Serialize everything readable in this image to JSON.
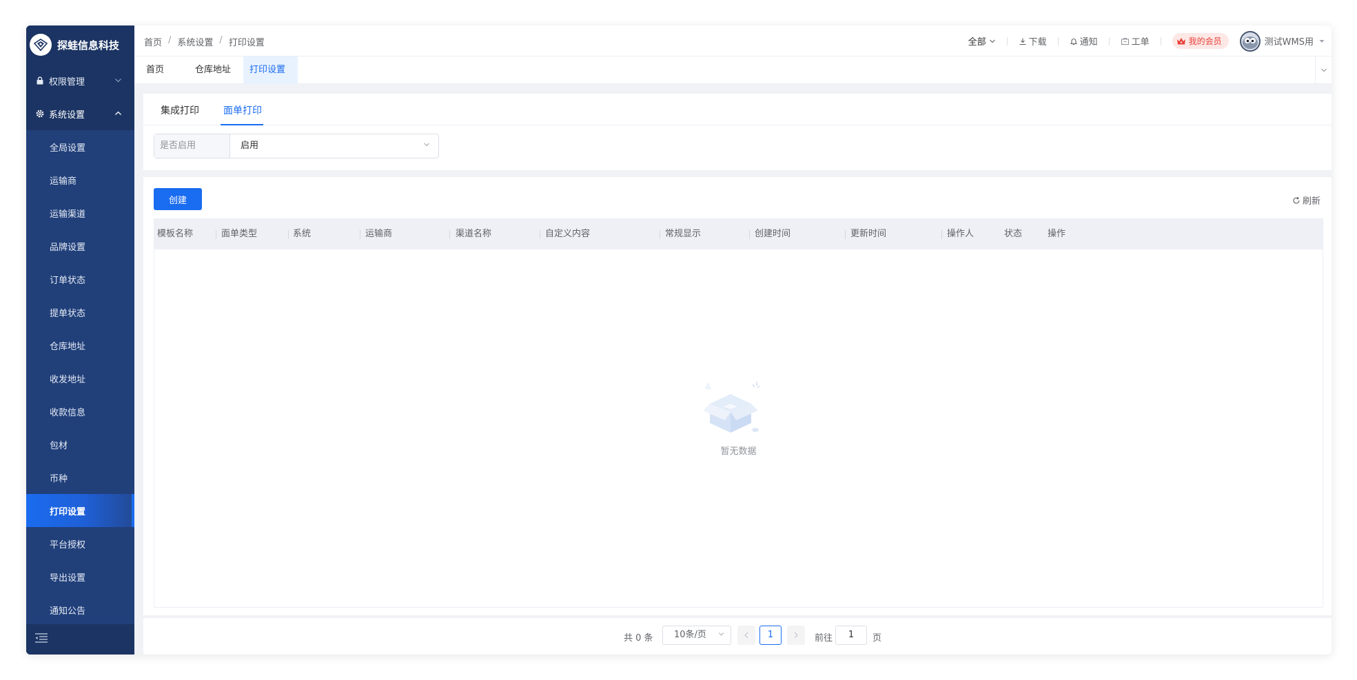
{
  "app": {
    "name": "探蛙信息科技"
  },
  "sidebar": {
    "groups": [
      {
        "label": "权限管理",
        "icon": "lock-icon",
        "expanded": false
      },
      {
        "label": "系统设置",
        "icon": "gear-icon",
        "expanded": true
      }
    ],
    "items": [
      {
        "label": "全局设置"
      },
      {
        "label": "运输商"
      },
      {
        "label": "运输渠道"
      },
      {
        "label": "品牌设置"
      },
      {
        "label": "订单状态"
      },
      {
        "label": "提单状态"
      },
      {
        "label": "仓库地址"
      },
      {
        "label": "收发地址"
      },
      {
        "label": "收款信息"
      },
      {
        "label": "包材"
      },
      {
        "label": "币种"
      },
      {
        "label": "打印设置",
        "active": true
      },
      {
        "label": "平台授权"
      },
      {
        "label": "导出设置"
      },
      {
        "label": "通知公告"
      }
    ]
  },
  "header": {
    "breadcrumb": [
      "首页",
      "系统设置",
      "打印设置"
    ],
    "scope": "全部",
    "download": "下载",
    "notify": "通知",
    "ticket": "工单",
    "vip": "我的会员",
    "user": "测试WMS用"
  },
  "tags": [
    {
      "label": "首页"
    },
    {
      "label": "仓库地址"
    },
    {
      "label": "打印设置",
      "active": true
    }
  ],
  "subtabs": [
    {
      "label": "集成打印"
    },
    {
      "label": "面单打印",
      "active": true
    }
  ],
  "filter": {
    "label": "是否启用",
    "value": "启用"
  },
  "toolbar": {
    "create": "创建",
    "refresh": "刷新"
  },
  "table": {
    "columns": [
      "模板名称",
      "面单类型",
      "系统",
      "运输商",
      "渠道名称",
      "自定义内容",
      "常规显示",
      "创建时间",
      "更新时间",
      "操作人",
      "状态",
      "操作"
    ],
    "rows": [],
    "empty_text": "暂无数据"
  },
  "pagination": {
    "total": "共 0 条",
    "page_size": "10条/页",
    "current": "1",
    "goto_label": "前往",
    "goto_value": "1",
    "goto_unit": "页"
  },
  "colors": {
    "primary": "#1a6cf0",
    "sidebar": "#1f3a6b",
    "vip": "#e8423a"
  }
}
